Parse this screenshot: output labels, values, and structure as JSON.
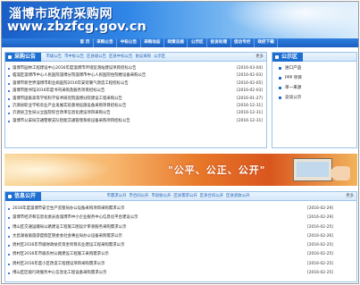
{
  "header": {
    "title": "淄博市政府采购网",
    "url": "www.zbzfcg.gov.cn"
  },
  "nav": [
    "首 页",
    "采购公告",
    "中标公告",
    "采购动态",
    "政策法规",
    "公示区",
    "投诉处理",
    "信访专栏",
    "政府下载"
  ],
  "procurement": {
    "title": "采购公告",
    "tabs": [
      "市级公告",
      "市中标公告",
      "区县级公告",
      "区县中标公告",
      "协议采购",
      "公示区"
    ],
    "more": "更多",
    "items": [
      {
        "text": "淄博市园林工程建设中心2016年度淄博市环境监测站建设项目招标公告",
        "date": "[2016-03-04]"
      },
      {
        "text": "临淄区淄博市中心人民医院淄博分院淄博市中心人民医院住院楼设备采购公告",
        "date": "[2016-02-03]"
      },
      {
        "text": "淄博市新世界淄博市职业病医院2016年安装暖气改造工程招标公告",
        "date": "[2016-02-05]"
      },
      {
        "text": "淄博市图书馆2016年度书刊采购及服务项目招标公告",
        "date": "[2016-02-03]"
      },
      {
        "text": "淄博市国家高等学校科学技术研究院淄博分院建设工程采购公告",
        "date": "[2016-01-27]"
      },
      {
        "text": "沂源县职业学校农业产业发展实验基地设施设备采购项目招标公告",
        "date": "[2016-12-31]"
      },
      {
        "text": "沂源县卫生局公立医院综合改革信息化建设项目采购公告",
        "date": "[2016-12-31]"
      },
      {
        "text": "淄博市公安局交通警察支队智能交通管理系统设备采购项目招标公告",
        "date": "[2016-12-31]"
      }
    ]
  },
  "notice": {
    "title": "公示区",
    "items": [
      "进口产品",
      "PPP 项目",
      "单一来源",
      "竞谈公示"
    ]
  },
  "banner": {
    "slogan": "\"公平、公正、公开\""
  },
  "info": {
    "title": "信息公开",
    "tabs": [
      "市需求公开",
      "市合同公开",
      "市验收公开",
      "区县需求公开",
      "区县合同公开",
      "区县验收公开"
    ],
    "more": "更多",
    "items": [
      {
        "text": "2016年度淄博市安全生产监管局办公设备采购项目采购需求公示",
        "date": "[2016-02-29]"
      },
      {
        "text": "淄博市经济和信息化委员会淄博市中小企业服务中心信息化平台建设公示",
        "date": "[2016-02-29]"
      },
      {
        "text": "博山区交通运输局公路建设工程施工图设计审查服务采购需求公示",
        "date": "[2016-02-25]"
      },
      {
        "text": "文昌湖省级旅游度假区管委会社会事业局办公设备采购需求公示",
        "date": "[2016-02-26]"
      },
      {
        "text": "周村区2016年市级财政扶贫资金项目农业建设工程采购需求公示",
        "date": "[2016-02-25]"
      },
      {
        "text": "周村区2016年市级农村公路建设工程施工采购需求公示",
        "date": "[2016-02-25]"
      },
      {
        "text": "周村区2016年度小区改造工程建设项目采购需求公示",
        "date": "[2016-02-25]"
      },
      {
        "text": "博山区区级行政服务中心信息化工程设备采购需求公示",
        "date": "[2016-02-25]"
      }
    ]
  },
  "colors": {
    "primary": "#1f6fd1",
    "border": "#9cc3ea",
    "banner_orange": "#e8782a"
  }
}
